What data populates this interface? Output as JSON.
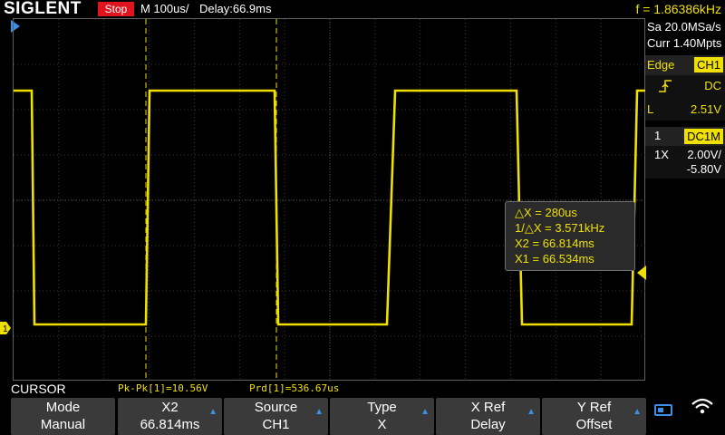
{
  "topbar": {
    "logo": "SIGLENT",
    "run_state": "Stop",
    "timebase": "M 100us/",
    "delay": "Delay:66.9ms",
    "frequency": "f = 1.86386kHz"
  },
  "acquisition": {
    "sample_rate": "Sa 20.0MSa/s",
    "memory": "Curr 1.40Mpts"
  },
  "trigger": {
    "type_label": "Edge",
    "source": "CH1",
    "slope_icon": "rising-edge-icon",
    "coupling": "DC",
    "level_label": "L",
    "level_value": "2.51V"
  },
  "channel": {
    "number": "1",
    "coupling": "DC1M",
    "probe": "1X",
    "scale": "2.00V/",
    "offset": "-5.80V",
    "marker_label": "1"
  },
  "cursor_readout": {
    "delta_x": "△X = 280us",
    "inv_delta_x": "1/△X = 3.571kHz",
    "x2": "X2 = 66.814ms",
    "x1": "X1 = 66.534ms"
  },
  "measurements": {
    "menu_title": "CURSOR",
    "pkpk": "Pk-Pk[1]=10.56V",
    "period": "Prd[1]=536.67us"
  },
  "softkeys": [
    {
      "title": "Mode",
      "value": "Manual",
      "arrow": false
    },
    {
      "title": "X2",
      "value": "66.814ms",
      "arrow": true
    },
    {
      "title": "Source",
      "value": "CH1",
      "arrow": true
    },
    {
      "title": "Type",
      "value": "X",
      "arrow": true
    },
    {
      "title": "X Ref",
      "value": "Delay",
      "arrow": true
    },
    {
      "title": "Y Ref",
      "value": "Offset",
      "arrow": true
    }
  ],
  "colors": {
    "trace": "#f0e000",
    "run_state_bg": "#e0141e",
    "accent_blue": "#3b8fe8",
    "softkey_bg": "#3a3a3a"
  },
  "icons": {
    "usb": "usb-icon",
    "wifi": "wifi-icon",
    "trigger_position_marker": "trigger-position-icon"
  }
}
